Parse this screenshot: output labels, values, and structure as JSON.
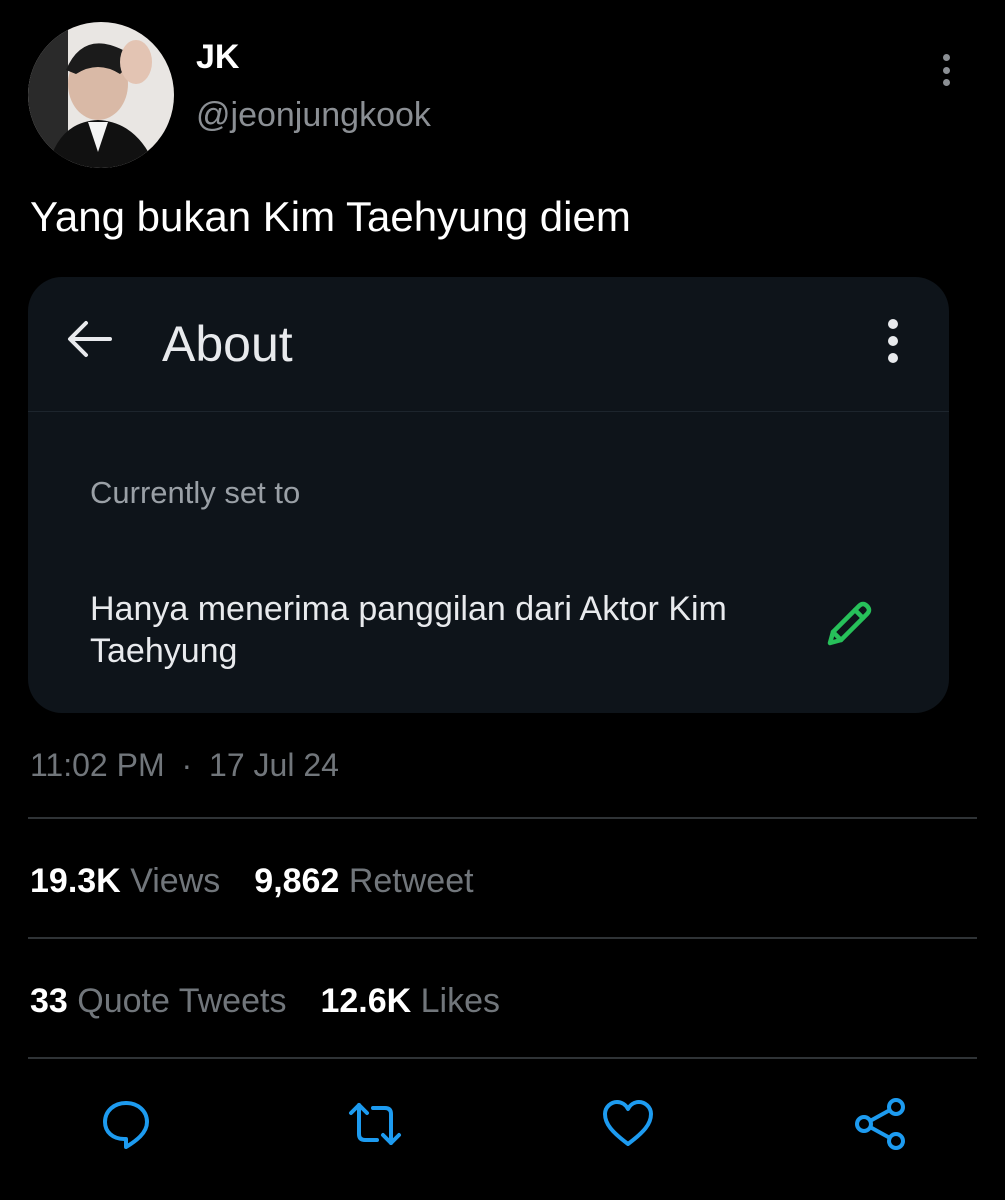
{
  "author": {
    "name": "JK",
    "handle": "@jeonjungkook"
  },
  "tweet": {
    "text": "Yang bukan Kim Taehyung diem",
    "time": "11:02 PM",
    "separator": "·",
    "date": "17 Jul 24"
  },
  "embedded_screenshot": {
    "title": "About",
    "label": "Currently set to",
    "status_text": "Hanya menerima panggilan dari Aktor Kim Taehyung",
    "icons": [
      "back-arrow-icon",
      "more-vertical-icon",
      "pencil-icon"
    ],
    "edit_icon_color": "#27c05a"
  },
  "stats": {
    "views_count": "19.3K",
    "views_label": "Views",
    "retweets_count": "9,862",
    "retweets_label": "Retweet",
    "quotes_count": "33",
    "quotes_label": "Quote Tweets",
    "likes_count": "12.6K",
    "likes_label": "Likes"
  },
  "actions": [
    "reply-icon",
    "retweet-icon",
    "like-icon",
    "share-icon"
  ],
  "colors": {
    "background": "#000000",
    "muted_text": "#71767b",
    "card_background": "#0e141a",
    "action_icon": "#1d9bf0"
  }
}
